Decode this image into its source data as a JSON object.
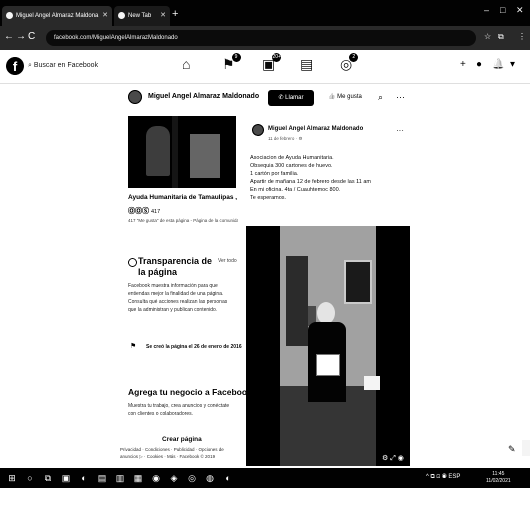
{
  "browser": {
    "tabs": [
      {
        "label": "Miguel Angel Almaraz Maldona"
      },
      {
        "label": "New Tab"
      }
    ],
    "new_tab_glyph": "+",
    "window_controls": [
      "–",
      "□",
      "✕"
    ],
    "nav": [
      "←",
      "→",
      "C",
      "⌂"
    ],
    "url": "facebook.com/MiguelAngelAlmarazMaldonado",
    "ext_icons": [
      "☆",
      "⧉",
      "⋮"
    ]
  },
  "facebook": {
    "logo": "f",
    "search_placeholder": "Buscar en Facebook",
    "nav_badges": [
      "9",
      "20+",
      "2"
    ],
    "right_icons": [
      "+",
      "●",
      "🔔",
      "▾"
    ]
  },
  "page": {
    "owner_name": "Miguel Angel Almaraz Maldonado",
    "call_button": "Llamar",
    "like_button": "Me gusta",
    "search_icon": "search-icon",
    "more_dots": "···",
    "title": "Ayuda Humanitaria de Tamaulipas , Redi...",
    "reaction_count": "417",
    "subtitle": "417 \"Me gusta\" de esta página - Página de la comunidad"
  },
  "transparency": {
    "title": "Transparencia de la página",
    "see_all": "Ver todo",
    "body": "Facebook muestra información para que entiendas mejor la finalidad de una página. Consulta qué acciones realizan las personas que la administran y publican contenido.",
    "created": "Se creó la página el 26 de enero de 2016"
  },
  "business": {
    "title": "Agrega tu negocio a Facebook",
    "body": "Muestra tu trabajo, crea anuncios y conéctate con clientes o colaboradores.",
    "button": "Crear página",
    "footer": "Privacidad · Condiciones · Publicidad · Opciones de anuncios ▷ · Cookies · Más · Facebook © 2019"
  },
  "post": {
    "author": "Miguel Angel Almaraz Maldonado",
    "date": "11 de febrero · ⚙",
    "lines": [
      "Asociacion de Ayuda Humanitaria.",
      "Obsequia 300 cartones de huevo.",
      "1 cartón por familia.",
      "Apartir de mañana 12 de febrero desde las 11 am",
      "En mi oficina. 4ta / Cuauhtemoc 800.",
      "Te esperamos."
    ],
    "photo_controls": "⚙ ⤢ ◉"
  },
  "taskbar": {
    "items": [
      "⊞",
      "○",
      "⧉",
      "▣",
      "◐",
      "▤",
      "▥",
      "▦",
      "◉",
      "◈",
      "◎",
      "◍",
      "◐"
    ],
    "tray": "^ ⧉ ⊡ ◉ ESP",
    "time": "11:45",
    "date": "11/02/2021"
  }
}
